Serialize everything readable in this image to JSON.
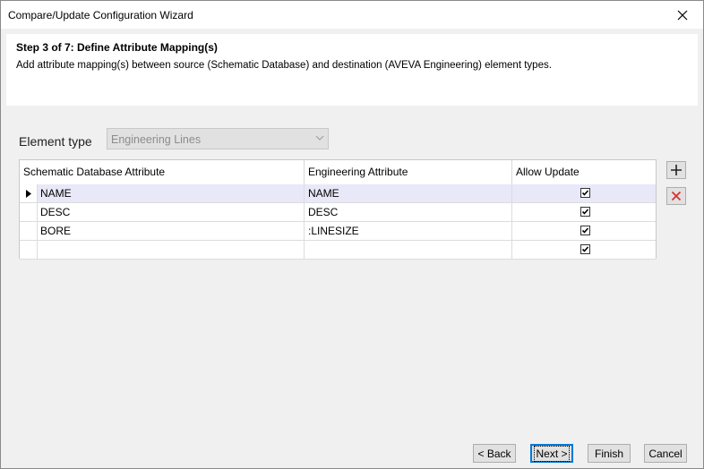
{
  "window": {
    "title": "Compare/Update Configuration Wizard"
  },
  "header": {
    "step_title": "Step 3 of 7: Define Attribute Mapping(s)",
    "description": "Add attribute mapping(s) between source (Schematic Database) and destination (AVEVA Engineering) element types."
  },
  "element_type": {
    "label": "Element type",
    "value": "Engineering Lines"
  },
  "grid": {
    "columns": [
      "Schematic Database Attribute",
      "Engineering Attribute",
      "Allow Update"
    ],
    "rows": [
      {
        "source": "NAME",
        "target": "NAME",
        "allow": true
      },
      {
        "source": "DESC",
        "target": "DESC",
        "allow": true
      },
      {
        "source": "BORE",
        "target": ":LINESIZE",
        "allow": true
      },
      {
        "source": "",
        "target": "",
        "allow": true
      }
    ]
  },
  "side_buttons": {
    "add": "add-icon",
    "remove": "delete-icon"
  },
  "footer": {
    "back_label": "< Back",
    "next_label": "Next >",
    "finish_label": "Finish",
    "cancel_label": "Cancel"
  },
  "colors": {
    "remove_icon": "#d9302c",
    "selected_row": "#e8e8f8",
    "default_button_border": "#0078d7"
  }
}
